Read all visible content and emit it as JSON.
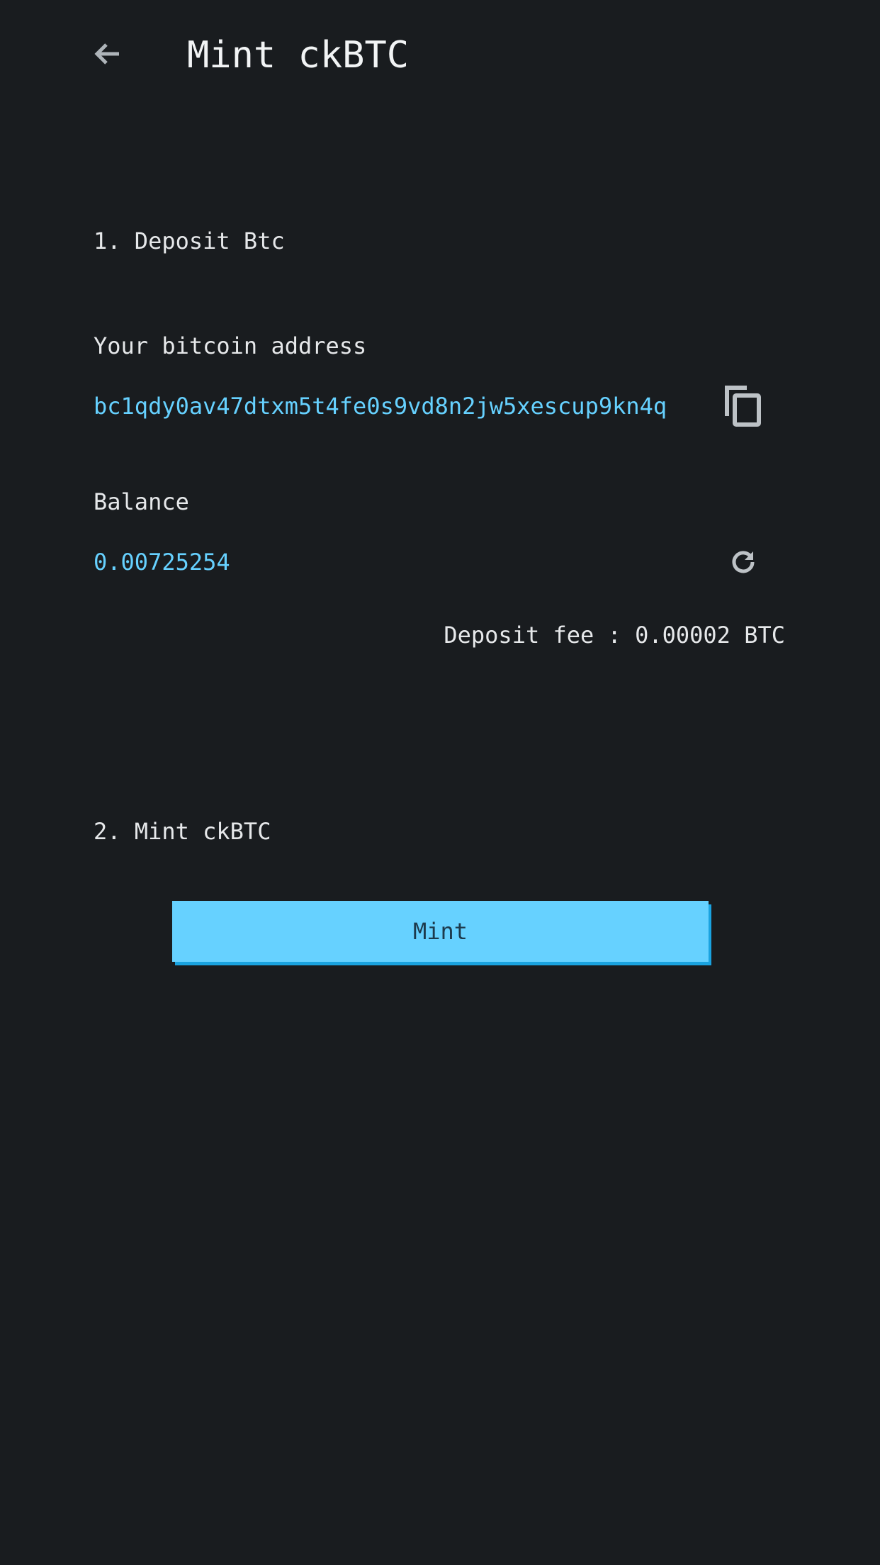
{
  "header": {
    "back_icon": "arrow-left-icon",
    "title": "Mint ckBTC"
  },
  "deposit": {
    "heading": "1. Deposit Btc",
    "address_label": "Your bitcoin address",
    "address": "bc1qdy0av47dtxm5t4fe0s9vd8n2jw5xescup9kn4q",
    "copy_icon": "copy-icon",
    "balance_label": "Balance",
    "balance": "0.00725254",
    "refresh_icon": "refresh-icon",
    "fee_text": "Deposit fee : 0.00002 BTC"
  },
  "mint": {
    "heading": "2. Mint ckBTC",
    "button_label": "Mint"
  },
  "colors": {
    "background": "#191c1f",
    "accent": "#66d1ff",
    "button_shadow": "#1aa3e0",
    "text": "#e6e8ea"
  }
}
